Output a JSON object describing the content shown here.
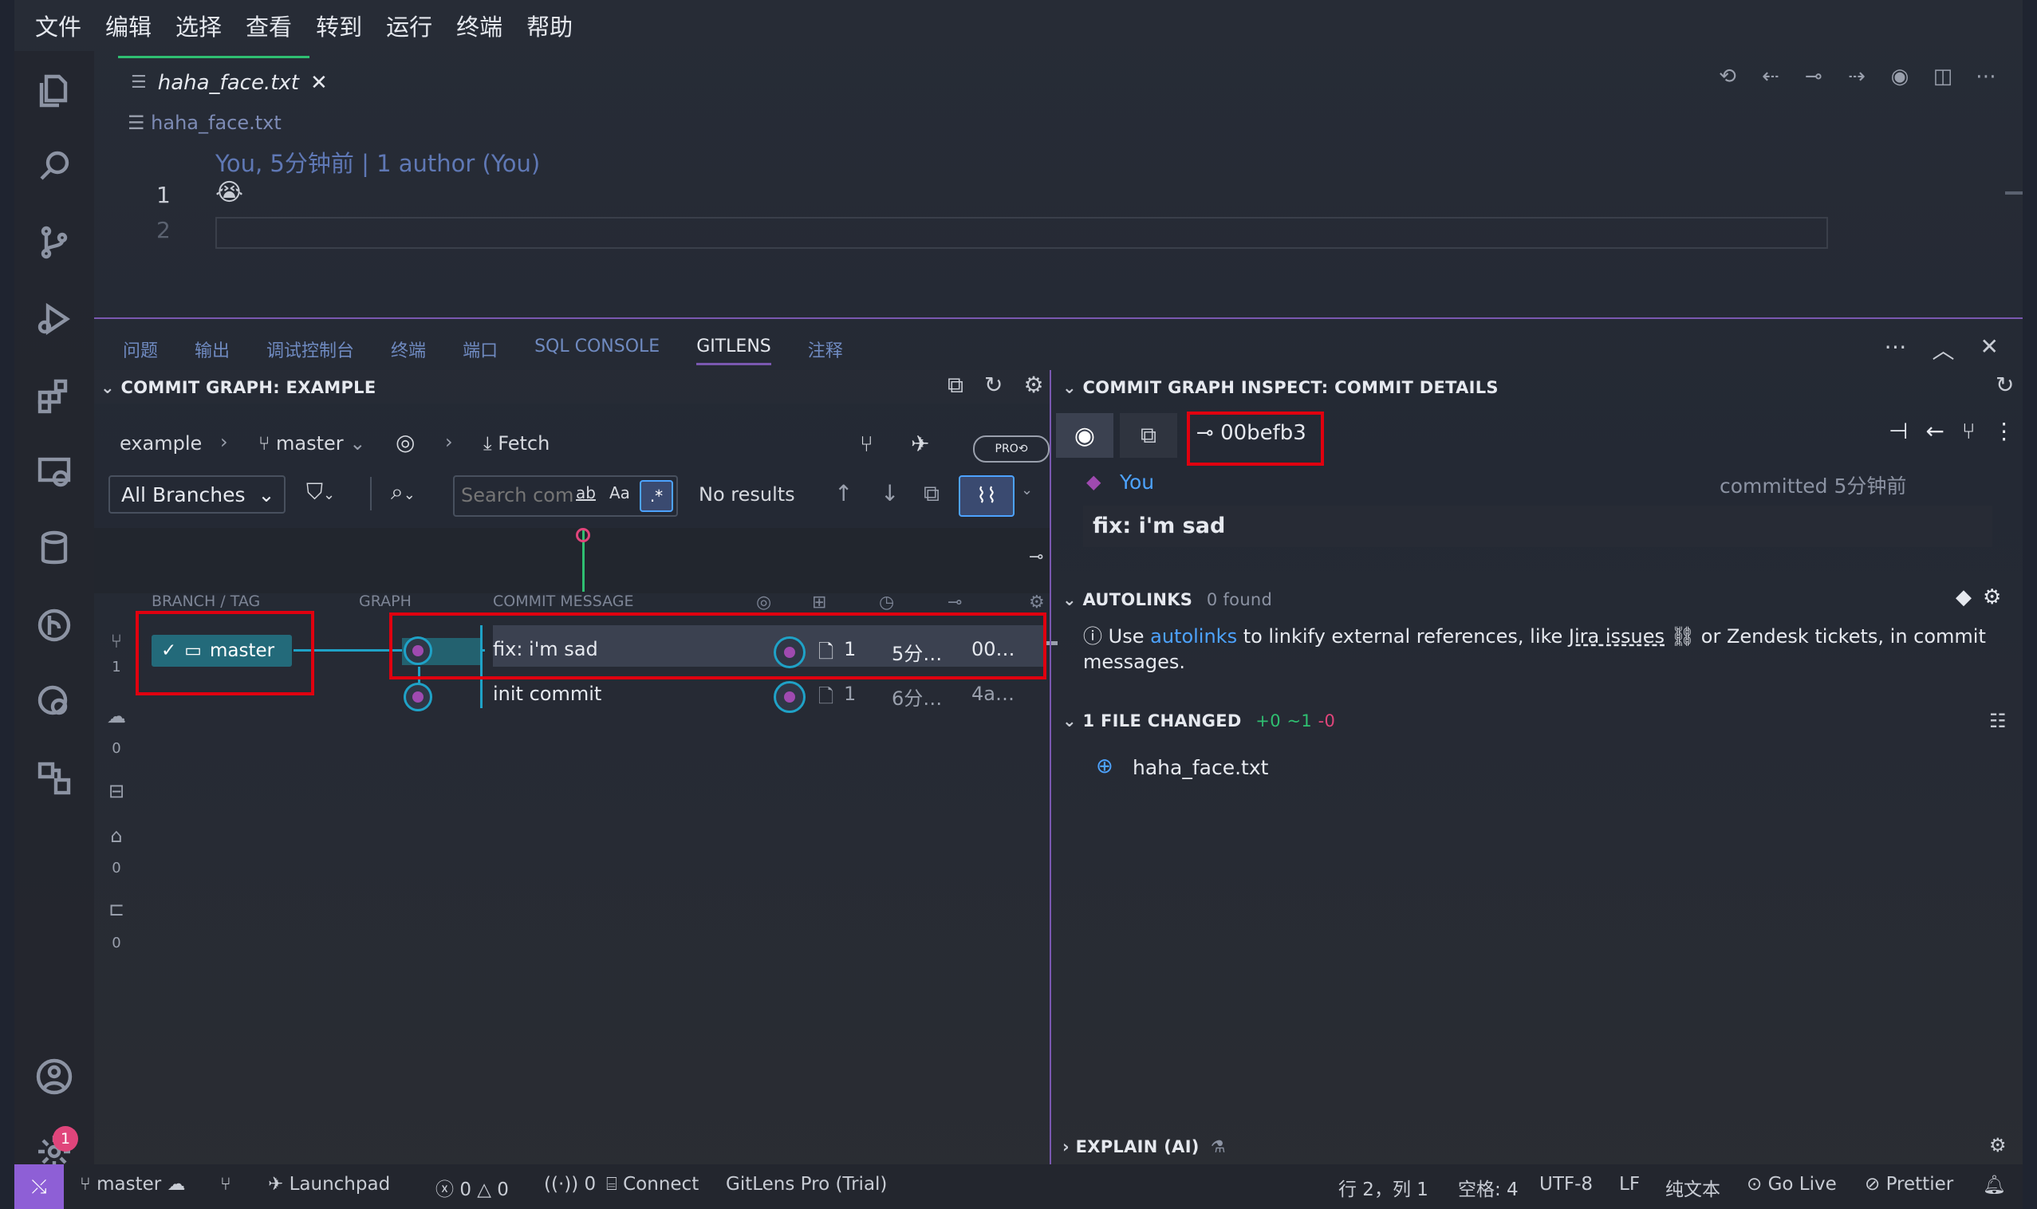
{
  "menu": [
    "文件",
    "编辑",
    "选择",
    "查看",
    "转到",
    "运行",
    "终端",
    "帮助"
  ],
  "editor": {
    "tab_name": "haha_face.txt",
    "breadcrumb": "haha_face.txt",
    "blame": "You, 5分钟前 | 1 author (You)",
    "lines": [
      {
        "num": "1",
        "text": "😭"
      },
      {
        "num": "2",
        "text": ""
      }
    ]
  },
  "panel": {
    "tabs": [
      "问题",
      "输出",
      "调试控制台",
      "终端",
      "端口",
      "SQL CONSOLE",
      "GITLENS",
      "注释"
    ],
    "active_tab": "GITLENS"
  },
  "graph": {
    "section_title": "COMMIT GRAPH: EXAMPLE",
    "repo": "example",
    "branch": "master",
    "fetch": "Fetch",
    "pro": "PRO",
    "branches_filter": "All Branches",
    "search_placeholder": "Search commits",
    "search_opt_ab": "ab",
    "search_opt_aa": "Aa",
    "search_opt_regex": ".*",
    "no_results": "No results",
    "columns": [
      "BRANCH / TAG",
      "GRAPH",
      "COMMIT MESSAGE"
    ],
    "side_counts": [
      "1",
      "0",
      "0",
      "0"
    ],
    "rows": [
      {
        "branch": "master",
        "message": "fix: i'm sad",
        "files": "1",
        "time": "5分…",
        "sha": "00…"
      },
      {
        "branch": "",
        "message": "init commit",
        "files": "1",
        "time": "6分…",
        "sha": "4a…"
      }
    ]
  },
  "details": {
    "section_title": "COMMIT GRAPH INSPECT: COMMIT DETAILS",
    "sha": "00befb3",
    "author": "You",
    "committed": "committed 5分钟前",
    "message": "fix: i'm sad",
    "autolinks_title": "AUTOLINKS",
    "autolinks_found": "0 found",
    "autolinks_text_1": "Use ",
    "autolinks_link": "autolinks",
    "autolinks_text_2": " to linkify external references, like ",
    "autolinks_jira": "Jira issues",
    "autolinks_text_3": " or Zendesk tickets, in commit messages.",
    "files_title": "1 FILE CHANGED",
    "files_stats": [
      "+0",
      "~1",
      "-0"
    ],
    "file_name": "haha_face.txt",
    "explain_title": "EXPLAIN (AI)"
  },
  "status": {
    "branch": "master",
    "launchpad": "Launchpad",
    "problems": "0",
    "warnings": "0",
    "ports": "0",
    "connect": "Connect",
    "gitlens": "GitLens Pro (Trial)",
    "position": "行 2，列 1",
    "spaces": "空格: 4",
    "encoding": "UTF-8",
    "eol": "LF",
    "language": "纯文本",
    "golive": "Go Live",
    "prettier": "Prettier"
  },
  "activity_badge": "1",
  "colors": {
    "accent": "#7a58b0",
    "highlight": "#e0000f",
    "node": "#1fa2c7",
    "link": "#4da3ff"
  }
}
